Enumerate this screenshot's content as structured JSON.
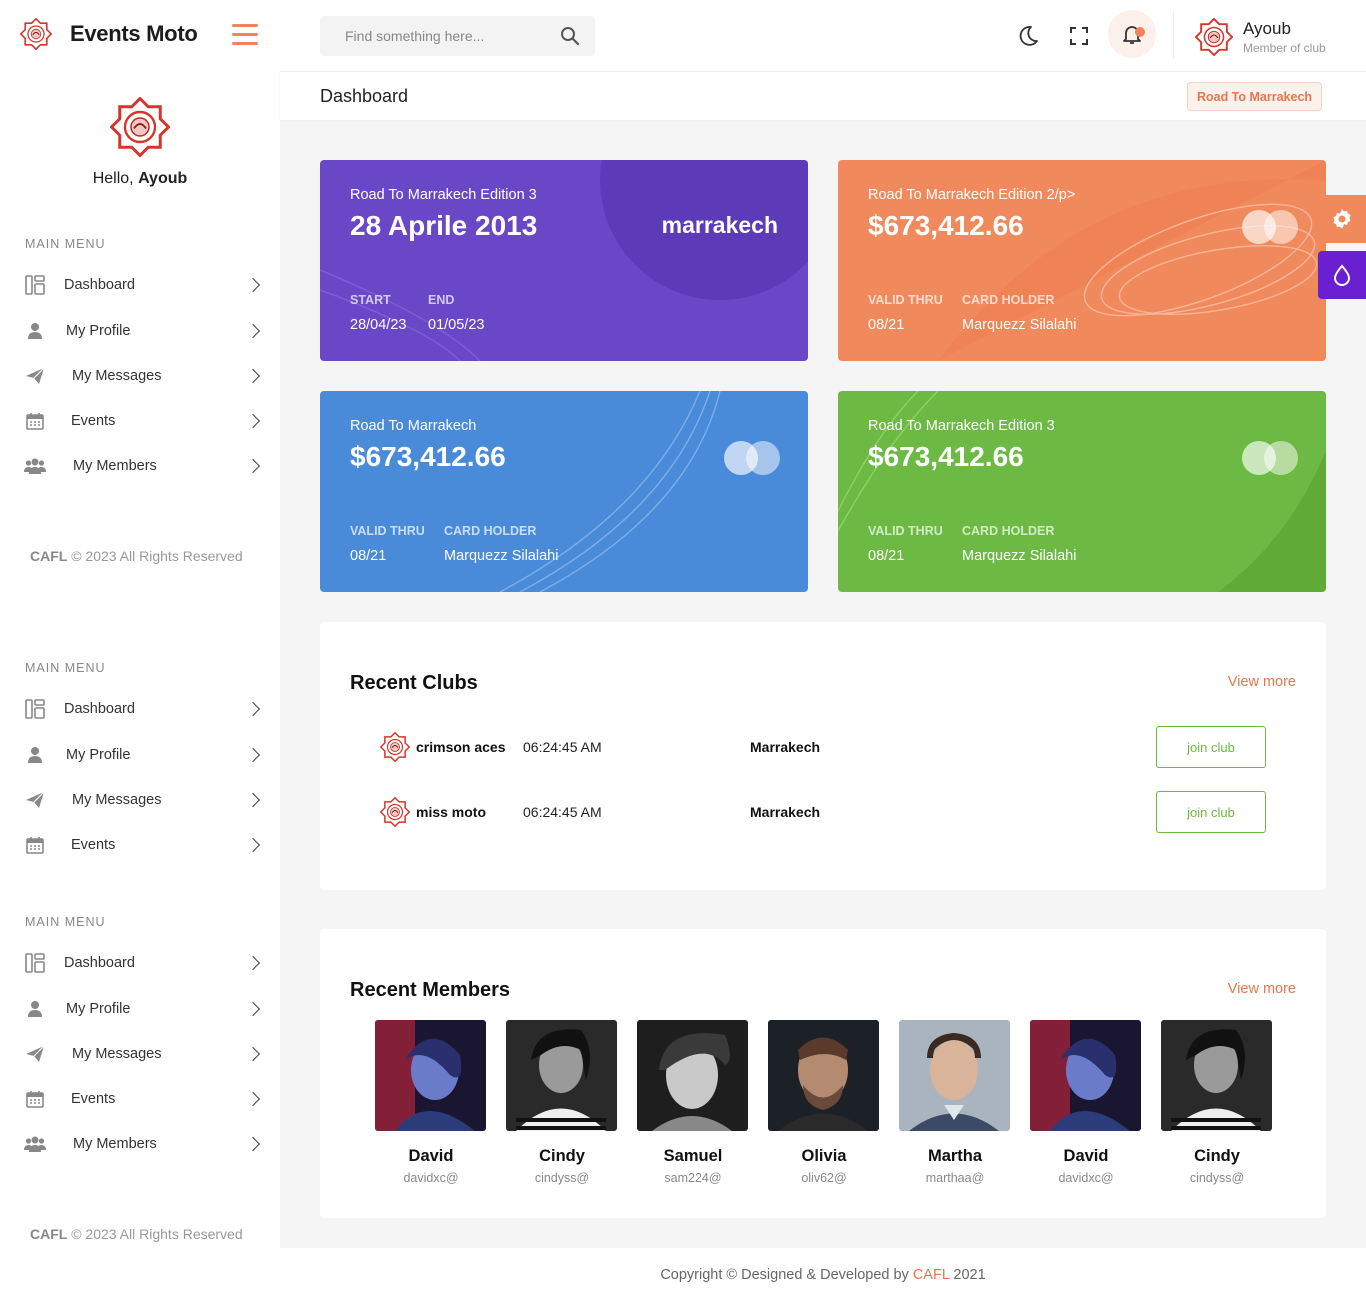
{
  "app": {
    "name": "Events Moto"
  },
  "sidebar": {
    "greeting": "Hello,",
    "user": "Ayoub",
    "menu_title": "MAIN MENU",
    "items": [
      {
        "label": "Dashboard",
        "icon": "dashboard-icon"
      },
      {
        "label": "My Profile",
        "icon": "user-icon"
      },
      {
        "label": "My Messages",
        "icon": "paper-plane-icon"
      },
      {
        "label": "Events",
        "icon": "calendar-icon"
      },
      {
        "label": "My Members",
        "icon": "users-icon"
      }
    ],
    "copyright_brand": "CAFL",
    "copyright_text": "© 2023 All Rights Reserved"
  },
  "topbar": {
    "search_placeholder": "Find something here...",
    "user_name": "Ayoub",
    "user_role": "Member of club"
  },
  "page": {
    "title": "Dashboard",
    "badge": "Road To Marrakech"
  },
  "cards": [
    {
      "subtitle": "Road To Marrakech Edition 3",
      "main": "28 Aprile 2013",
      "right": "marrakech",
      "label1": "START",
      "value1": "28/04/23",
      "label2": "END",
      "value2": "01/05/23",
      "color": "#6a47c6"
    },
    {
      "subtitle": "Road To Marrakech Edition 2/p>",
      "main": "$673,412.66",
      "label1": "VALID THRU",
      "value1": "08/21",
      "label2": "CARD HOLDER",
      "value2": "Marquezz Silalahi",
      "color": "#f08a5d"
    },
    {
      "subtitle": "Road To Marrakech",
      "main": "$673,412.66",
      "label1": "VALID THRU",
      "value1": "08/21",
      "label2": "CARD HOLDER",
      "value2": "Marquezz Silalahi",
      "color": "#4a8bd9"
    },
    {
      "subtitle": "Road To Marrakech Edition 3",
      "main": "$673,412.66",
      "label1": "VALID THRU",
      "value1": "08/21",
      "label2": "CARD HOLDER",
      "value2": "Marquezz Silalahi",
      "color": "#6cb944"
    }
  ],
  "recent_clubs": {
    "title": "Recent Clubs",
    "view_more": "View more",
    "rows": [
      {
        "name": "crimson aces",
        "time": "06:24:45 AM",
        "city": "Marrakech",
        "action": "join club"
      },
      {
        "name": "miss moto",
        "time": "06:24:45 AM",
        "city": "Marrakech",
        "action": "join club"
      }
    ]
  },
  "recent_members": {
    "title": "Recent Members",
    "view_more": "View more",
    "members": [
      {
        "name": "David",
        "handle": "davidxc@"
      },
      {
        "name": "Cindy",
        "handle": "cindyss@"
      },
      {
        "name": "Samuel",
        "handle": "sam224@"
      },
      {
        "name": "Olivia",
        "handle": "oliv62@"
      },
      {
        "name": "Martha",
        "handle": "marthaa@"
      },
      {
        "name": "David",
        "handle": "davidxc@"
      },
      {
        "name": "Cindy",
        "handle": "cindyss@"
      }
    ]
  },
  "footer": {
    "prefix": "Copyright © Designed & Developed by",
    "brand": "CAFL",
    "year": "2021"
  },
  "colors": {
    "accent": "#f0845c",
    "purple": "#6a47c6",
    "orange": "#f08a5d",
    "blue": "#4a8bd9",
    "green": "#6cb944"
  }
}
